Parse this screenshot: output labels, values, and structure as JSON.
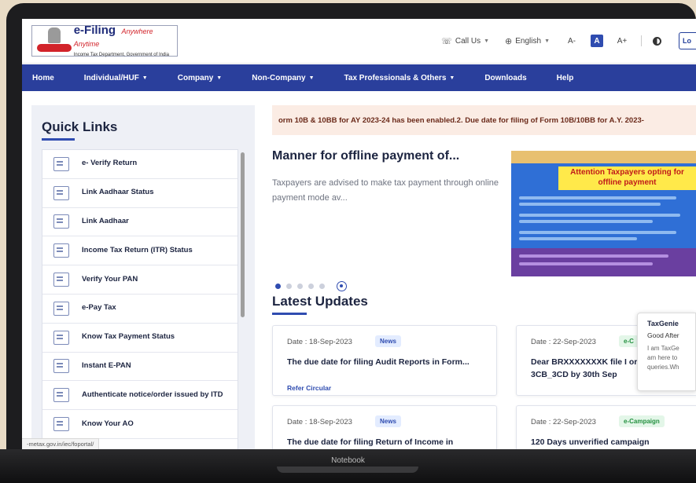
{
  "device": {
    "label": "Notebook"
  },
  "header": {
    "logo_title": "e-Filing",
    "logo_tagline": "Anywhere Anytime",
    "logo_subtitle": "Income Tax Department, Government of India",
    "call_us": "Call Us",
    "language": "English",
    "font_decrease": "A-",
    "font_normal": "A",
    "font_increase": "A+",
    "login_label": "Lo"
  },
  "nav": {
    "items": [
      {
        "label": "Home"
      },
      {
        "label": "Individual/HUF"
      },
      {
        "label": "Company"
      },
      {
        "label": "Non-Company"
      },
      {
        "label": "Tax Professionals & Others"
      },
      {
        "label": "Downloads"
      },
      {
        "label": "Help"
      }
    ]
  },
  "quick_links": {
    "title": "Quick Links",
    "items": [
      {
        "label": "e- Verify Return"
      },
      {
        "label": "Link Aadhaar Status"
      },
      {
        "label": "Link Aadhaar"
      },
      {
        "label": "Income Tax Return (ITR) Status"
      },
      {
        "label": "Verify Your PAN"
      },
      {
        "label": "e-Pay Tax"
      },
      {
        "label": "Know Tax Payment Status"
      },
      {
        "label": "Instant E-PAN"
      },
      {
        "label": "Authenticate notice/order issued by ITD"
      },
      {
        "label": "Know Your AO"
      }
    ]
  },
  "status_bar": {
    "url": "-metax.gov.in/iec/foportal/"
  },
  "ticker": {
    "text": "orm 10B & 10BB for AY 2023-24 has been enabled.2. Due date for filing of Form 10B/10BB for A.Y. 2023-"
  },
  "featured": {
    "title": "Manner for offline payment of...",
    "description": "Taxpayers are advised to make tax payment through online payment mode av...",
    "banner_heading": "Attention Taxpayers opting for offline payment"
  },
  "latest_updates": {
    "title": "Latest Updates",
    "cards": [
      {
        "date": "Date : 18-Sep-2023",
        "badge": "News",
        "title": "The due date for filing Audit Reports in Form...",
        "link": "Refer Circular"
      },
      {
        "date": "Date : 22-Sep-2023",
        "badge": "e-C",
        "title": "Dear BRXXXXXXXK file I or 3CB_3CD by 30th Sep",
        "link": ""
      },
      {
        "date": "Date : 18-Sep-2023",
        "badge": "News",
        "title": "The due date for filing Return of Income in",
        "link": ""
      },
      {
        "date": "Date : 22-Sep-2023",
        "badge": "e-Campaign",
        "title": "120 Days unverified campaign",
        "link": ""
      }
    ]
  },
  "chat": {
    "name": "TaxGenie",
    "greeting": "Good After",
    "message": "I am TaxGe am here to queries.Wh"
  }
}
